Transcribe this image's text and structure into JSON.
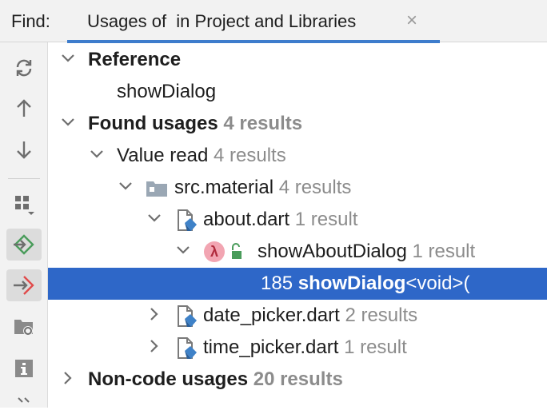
{
  "header": {
    "find_label": "Find:",
    "tab_title": "Usages of  in Project and Libraries",
    "close_glyph": "×"
  },
  "toolbar": {
    "items": [
      "refresh-icon",
      "arrow-up-icon",
      "arrow-down-icon",
      "group-by-icon",
      "preview-usages-icon",
      "navigate-source-icon",
      "module-group-icon",
      "info-icon"
    ]
  },
  "tree": {
    "reference": {
      "label": "Reference",
      "value": "showDialog"
    },
    "found": {
      "label": "Found usages",
      "count": "4 results"
    },
    "value_read": {
      "label": "Value read",
      "count": "4 results"
    },
    "package": {
      "label": "src.material",
      "count": "4 results"
    },
    "about": {
      "label": "about.dart",
      "count": "1 result"
    },
    "method": {
      "label": "showAboutDialog",
      "count": "1 result",
      "lambda": "λ"
    },
    "usage_line": {
      "line_number": "185",
      "bold": "showDialog",
      "rest": "<void>("
    },
    "date_picker": {
      "label": "date_picker.dart",
      "count": "2 results"
    },
    "time_picker": {
      "label": "time_picker.dart",
      "count": "1 result"
    },
    "non_code": {
      "label": "Non-code usages",
      "count": "20 results"
    }
  },
  "colors": {
    "selection": "#2e67c8",
    "tab_underline": "#3d7ccc",
    "lambda_badge": "#f2a5b2"
  }
}
